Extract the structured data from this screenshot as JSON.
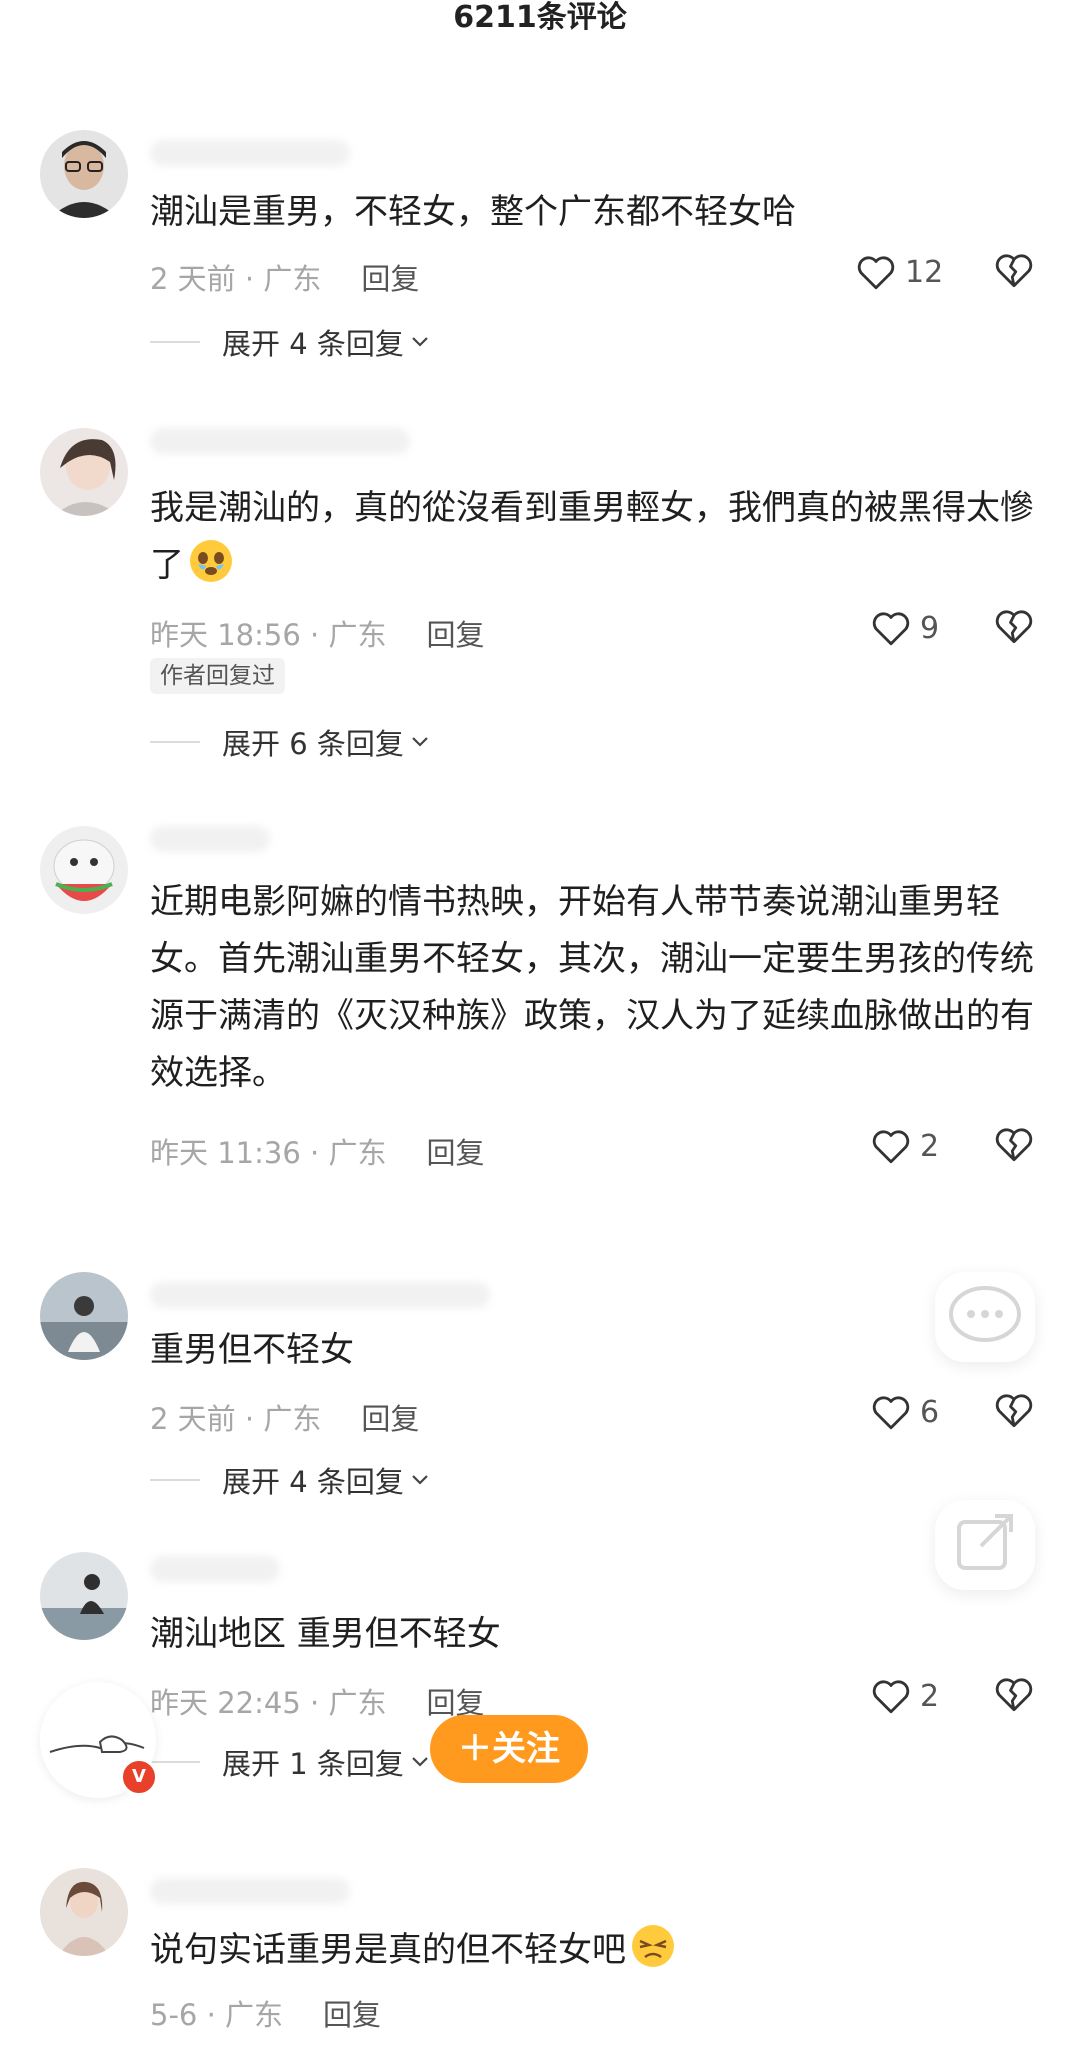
{
  "header": {
    "title": "6211条评论"
  },
  "comments": [
    {
      "text": "潮汕是重男，不轻女，整个广东都不轻女哈",
      "time": "2 天前 · 广东",
      "reply": "回复",
      "likes": "12",
      "expand": "展开 4 条回复"
    },
    {
      "text": "我是潮汕的，真的從沒看到重男輕女，我們真的被黑得太慘了",
      "time": "昨天 18:56 · 广东",
      "reply": "回复",
      "likes": "9",
      "badge": "作者回复过",
      "expand": "展开 6 条回复"
    },
    {
      "text": "近期电影阿嫲的情书热映，开始有人带节奏说潮汕重男轻女。首先潮汕重男不轻女，其次，潮汕一定要生男孩的传统源于满清的《灭汉种族》政策，汉人为了延续血脉做出的有效选择。",
      "time": "昨天 11:36 · 广东",
      "reply": "回复",
      "likes": "2"
    },
    {
      "text": "重男但不轻女",
      "time": "2 天前 · 广东",
      "reply": "回复",
      "likes": "6",
      "expand": "展开 4 条回复"
    },
    {
      "text": "潮汕地区 重男但不轻女",
      "time": "昨天 22:45 · 广东",
      "reply": "回复",
      "likes": "2",
      "expand": "展开 1 条回复"
    },
    {
      "text": "说句实话重男是真的但不轻女吧",
      "time": "5-6 · 广东",
      "reply": "回复"
    }
  ],
  "follow_button": "＋关注",
  "icons": {
    "like": "heart-icon",
    "dislike": "broken-heart-icon",
    "chevron": "chevron-down-icon",
    "comment_float": "comment-bubble-icon",
    "share_float": "share-icon"
  },
  "colors": {
    "follow": "#ff9a1f",
    "meta": "#a6a6a6",
    "verified": "#e8402a"
  }
}
